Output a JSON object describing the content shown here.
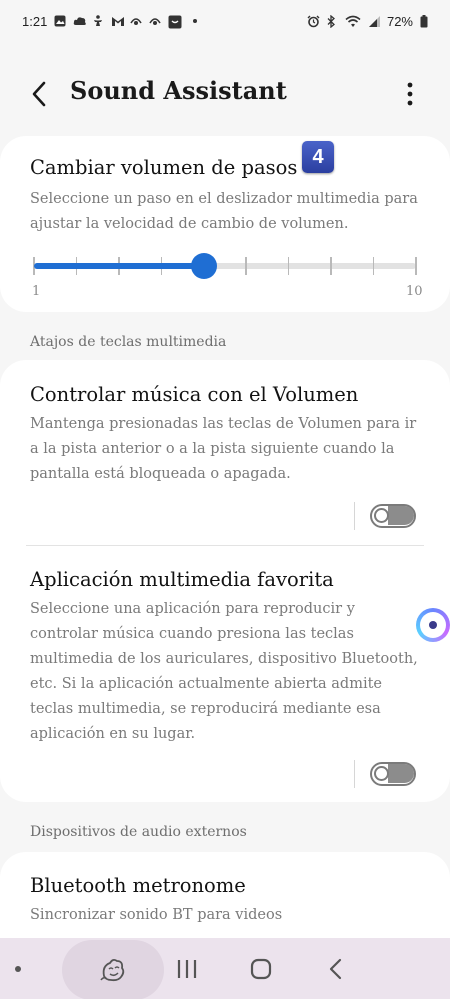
{
  "status_bar": {
    "time": "1:21",
    "battery": "72%",
    "left_icons": [
      "gallery-icon",
      "cloud-icon",
      "accessibility-icon",
      "gmail-icon",
      "bixby-icon",
      "bixby-icon",
      "shopping-bag-icon",
      "more-notifications-dot"
    ],
    "right_icons": [
      "alarm-icon",
      "bluetooth-icon",
      "wifi-icon",
      "signal-icon",
      "battery-icon"
    ]
  },
  "app_bar": {
    "title": "Sound Assistant"
  },
  "volume_steps": {
    "title": "Cambiar volumen de pasos",
    "badge": "4",
    "description": "Seleccione un paso en el deslizador multimedia para ajustar la velocidad de cambio de volumen.",
    "slider_min_label": "1",
    "slider_max_label": "10",
    "slider": {
      "min": 1,
      "max": 10,
      "value": 5
    }
  },
  "media_shortcuts": {
    "section_header": "Atajos de teclas multimedia",
    "control_music": {
      "title": "Controlar música con el Volumen",
      "description": "Mantenga presionadas las teclas de Volumen para ir a la pista anterior o a la pista siguiente cuando la pantalla está bloqueada o apagada.",
      "toggle_on": false
    },
    "favorite_app": {
      "title": "Aplicación multimedia favorita",
      "description": "Seleccione una aplicación para reproducir y controlar música cuando presiona las teclas multimedia de los auriculares, dispositivo Bluetooth, etc. Si la aplicación actualmente abierta admite teclas multimedia, se reproducirá mediante esa aplicación en su lugar.",
      "toggle_on": false
    }
  },
  "external_audio": {
    "section_header": "Dispositivos de audio externos",
    "bluetooth_metronome": {
      "title": "Bluetooth metronome",
      "description": "Sincronizar sonido BT para videos"
    }
  },
  "colors": {
    "accent": "#1f6ed3",
    "background": "#f6f6f6",
    "card": "#ffffff",
    "nav_bar": "#ece3ed",
    "badge": "#2f45a8"
  }
}
